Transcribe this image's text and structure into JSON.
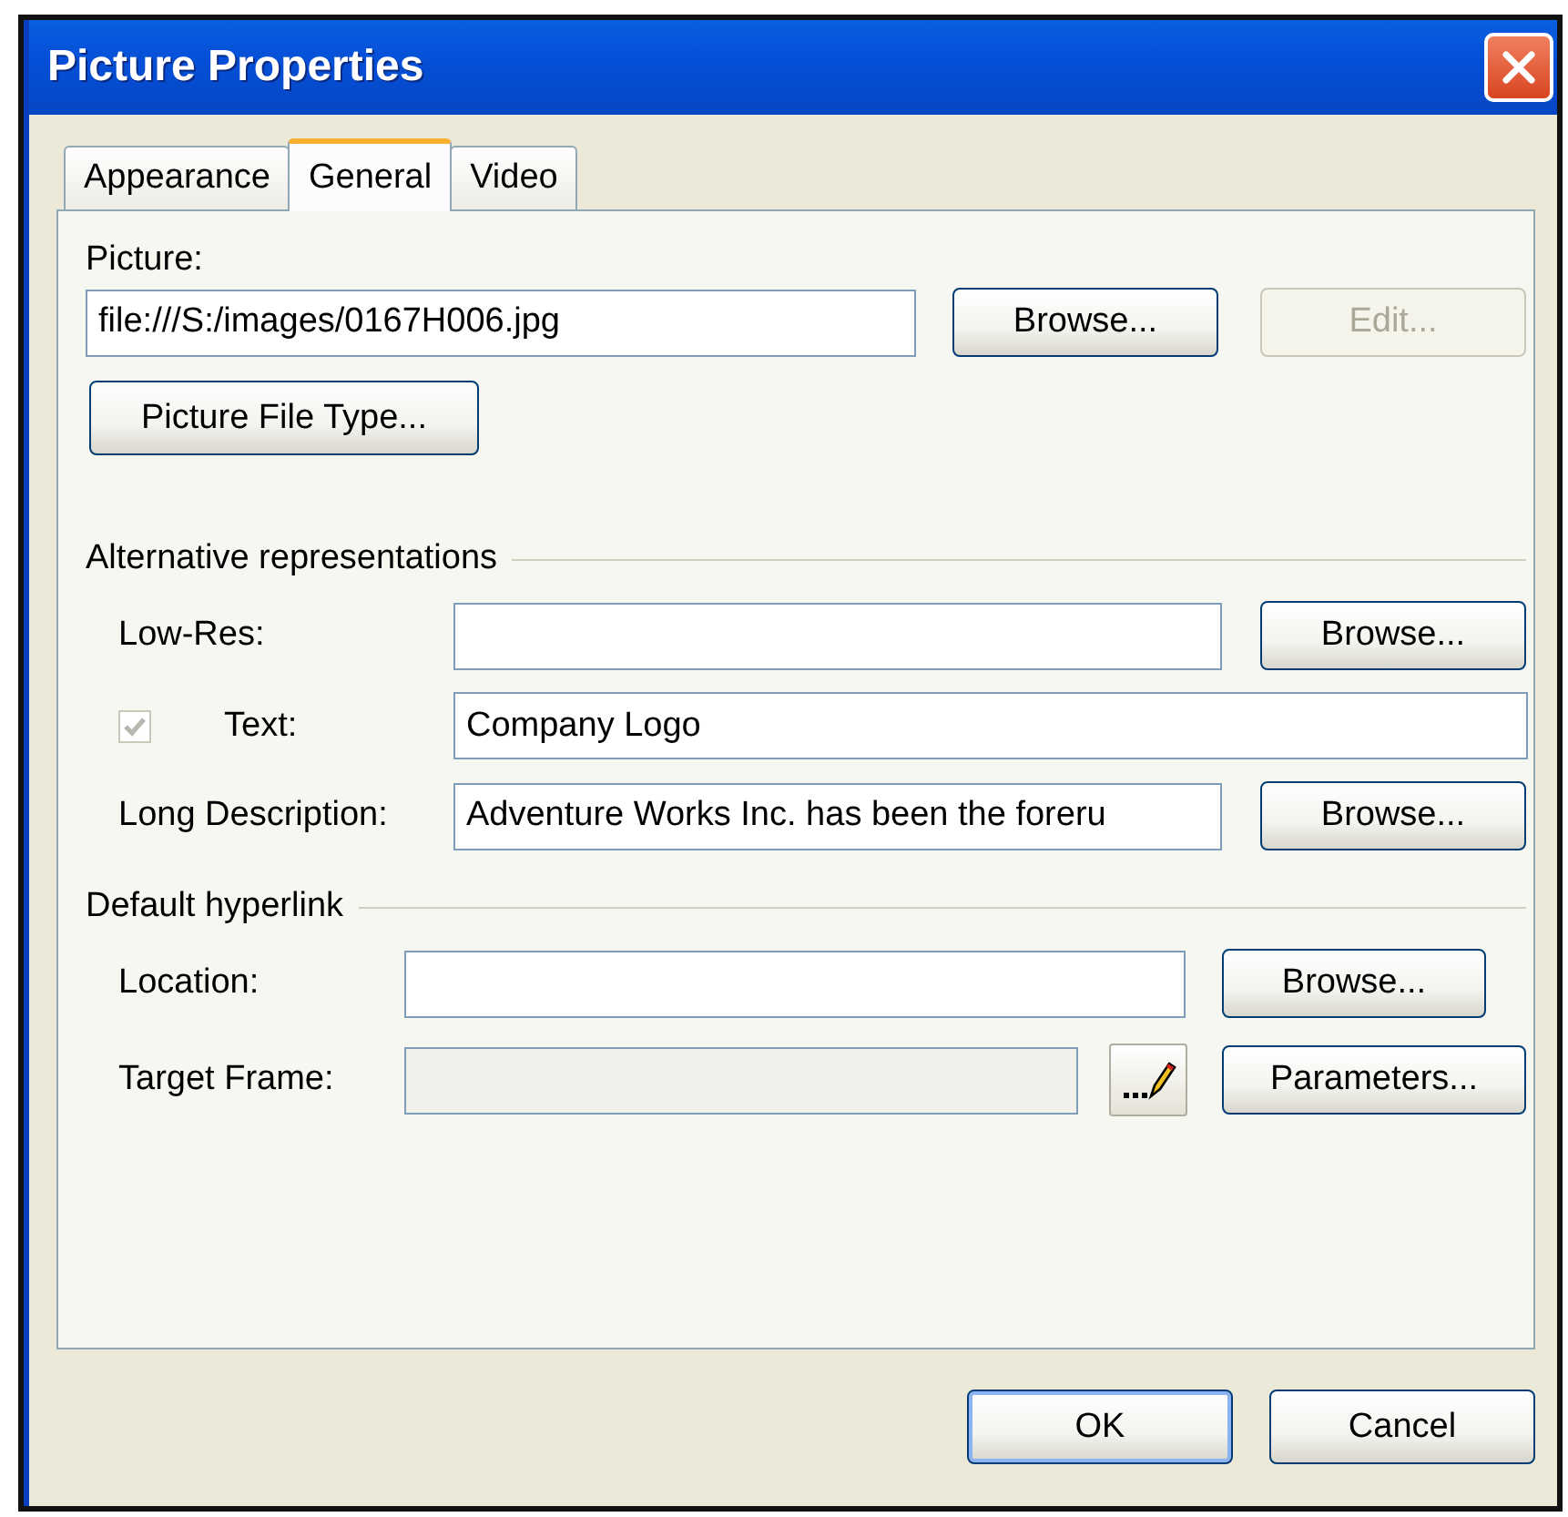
{
  "window": {
    "title": "Picture Properties"
  },
  "tabs": [
    {
      "label": "Appearance",
      "selected": false
    },
    {
      "label": "General",
      "selected": true
    },
    {
      "label": "Video",
      "selected": false
    }
  ],
  "picture": {
    "label": "Picture:",
    "value": "file:///S:/images/0167H006.jpg",
    "field_disabled": false,
    "buttons": [
      {
        "label": "Browse...",
        "disabled": false
      },
      {
        "label": "Edit...",
        "disabled": true
      }
    ],
    "file_type_button": {
      "label": "Picture File Type...",
      "disabled": false
    }
  },
  "alternative_representations": {
    "title": "Alternative representations",
    "low_res": {
      "label": "Low-Res:",
      "field_disabled": false,
      "browse": {
        "label": "Browse...",
        "disabled": false
      }
    },
    "text": {
      "label": "Text:",
      "checked": true,
      "check_disabled": true,
      "value": "Company Logo",
      "field_disabled": false
    },
    "long_description": {
      "label": "Long Description:",
      "value": "Adventure Works Inc. has been the foreru",
      "field_disabled": false,
      "browse": {
        "label": "Browse...",
        "disabled": false
      }
    }
  },
  "default_hyperlink": {
    "title": "Default hyperlink",
    "location": {
      "label": "Location:",
      "field_disabled": false,
      "browse": {
        "label": "Browse...",
        "disabled": false
      }
    },
    "target_frame": {
      "label": "Target Frame:",
      "field_disabled": true,
      "parameters": {
        "label": "Parameters...",
        "disabled": false
      }
    }
  },
  "dialog_buttons": [
    {
      "label": "OK",
      "default": true,
      "disabled": false
    },
    {
      "label": "Cancel",
      "default": false,
      "disabled": false
    }
  ]
}
